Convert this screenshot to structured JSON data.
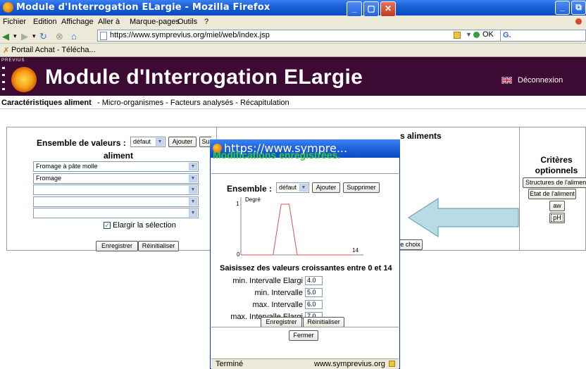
{
  "window": {
    "title": "Module d'Interrogation ELargie - Mozilla Firefox",
    "min_symbol": "_",
    "max_symbol": "⧉"
  },
  "menu": {
    "items": [
      "Fichier",
      "Edition",
      "Affichage",
      "Aller à",
      "Marque-pages",
      "Outils",
      "?"
    ]
  },
  "nav": {
    "url": "https://www.symprevius.org/miel/web/index.jsp",
    "go_label": "OK",
    "search_prefix": "G."
  },
  "bookmarks": {
    "item": "Portail Achat - Télécha..."
  },
  "banner": {
    "brand": "PREVIUS",
    "title": "Module d'Interrogation ELargie",
    "logout": "Déconnexion"
  },
  "crumbs": {
    "active": "Caractéristiques aliment",
    "rest": " - Micro-organismes - Facteurs analysés - Récapitulation"
  },
  "left_panel": {
    "ensemble_label": "Ensemble de valeurs :",
    "ensemble_value": "défaut",
    "add_label": "Ajouter",
    "del_label_partial": "Su",
    "heading": "aliment",
    "selects": [
      "Fromage à pâte molle",
      "Fromage",
      "",
      "",
      ""
    ],
    "extend_label": "Elargir la sélection",
    "save_label": "Enregistrer",
    "reset_label": "Réinitialiser"
  },
  "middle_panel": {
    "heading_partial": "s aliments",
    "choice_partial": "e choix"
  },
  "right_panel": {
    "heading_line1": "Critères",
    "heading_line2": "optionnels",
    "buttons": [
      "Structures de l'aliment",
      "Etat de l'aliment",
      "aw",
      "pH"
    ]
  },
  "popup": {
    "title": "https://www.sympre...",
    "message": "Modifications enregistrées.",
    "ensemble_label": "Ensemble :",
    "ensemble_value": "défaut",
    "add_label": "Ajouter",
    "delete_label": "Supprimer",
    "chart_ylabel": "Degré",
    "chart_y_tick_top": "1",
    "chart_y_tick_zero": "0",
    "chart_x_tick_end": "14",
    "instruction": "Saisissez des valeurs croissantes entre 0 et 14",
    "fields": [
      {
        "label": "min. Intervalle Elargi",
        "value": "4.0"
      },
      {
        "label": "min. Intervalle",
        "value": "5.0"
      },
      {
        "label": "max. Intervalle",
        "value": "6.0"
      },
      {
        "label": "max. Intervalle Elargi",
        "value": "7.0"
      }
    ],
    "save_label": "Enregistrer",
    "reset_label": "Réinitialiser",
    "close_label": "Fermer",
    "status_left": "Terminé",
    "status_right": "www.symprevius.org"
  },
  "chart_data": {
    "type": "line",
    "x": [
      0,
      4,
      5,
      6,
      7,
      14
    ],
    "y": [
      0,
      0,
      1,
      1,
      0,
      0
    ],
    "xlim": [
      0,
      14
    ],
    "ylim": [
      0,
      1
    ],
    "ylabel": "Degré"
  },
  "colors": {
    "banner_bg": "#3d0a33",
    "title_blue": "#0a4bc4",
    "message_green": "#33cc33",
    "trapezoid": "#e05050",
    "arrow_fill": "#b9dbe6"
  }
}
